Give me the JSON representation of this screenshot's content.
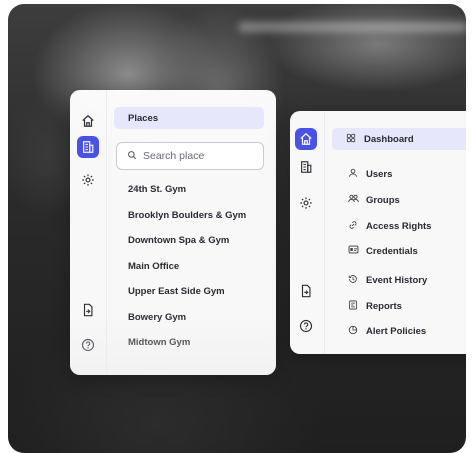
{
  "panel_left": {
    "header": "Places",
    "search": {
      "placeholder": "Search place"
    },
    "places": [
      "24th St. Gym",
      "Brooklyn Boulders & Gym",
      "Downtown Spa & Gym",
      "Main Office",
      "Upper East Side Gym",
      "Bowery Gym",
      "Midtown Gym"
    ],
    "rail_icons": [
      "home-icon",
      "building-icon",
      "gear-icon",
      "file-export-icon",
      "help-circle-icon"
    ],
    "active_icon": "building-icon"
  },
  "panel_right": {
    "nav": [
      {
        "label": "Dashboard",
        "icon": "grid-icon",
        "glyph": "88"
      },
      {
        "label": "Users",
        "icon": "user-icon",
        "glyph": "⚇"
      },
      {
        "label": "Groups",
        "icon": "users-icon",
        "glyph": "⚇⚇"
      },
      {
        "label": "Access Rights",
        "icon": "link-icon",
        "glyph": "∞"
      },
      {
        "label": "Credentials",
        "icon": "id-card-icon",
        "glyph": "▣"
      },
      {
        "label": "Event History",
        "icon": "history-icon",
        "glyph": "↺"
      },
      {
        "label": "Reports",
        "icon": "report-icon",
        "glyph": "☰"
      },
      {
        "label": "Alert Policies",
        "icon": "alert-shield-icon",
        "glyph": "◔"
      }
    ],
    "rail_icons": [
      "home-icon",
      "building-icon",
      "gear-icon",
      "file-export-icon",
      "help-circle-icon"
    ],
    "active_icon": "home-icon"
  },
  "colors": {
    "accent": "#4a52e6",
    "selected_bg": "#e6e7fb"
  }
}
